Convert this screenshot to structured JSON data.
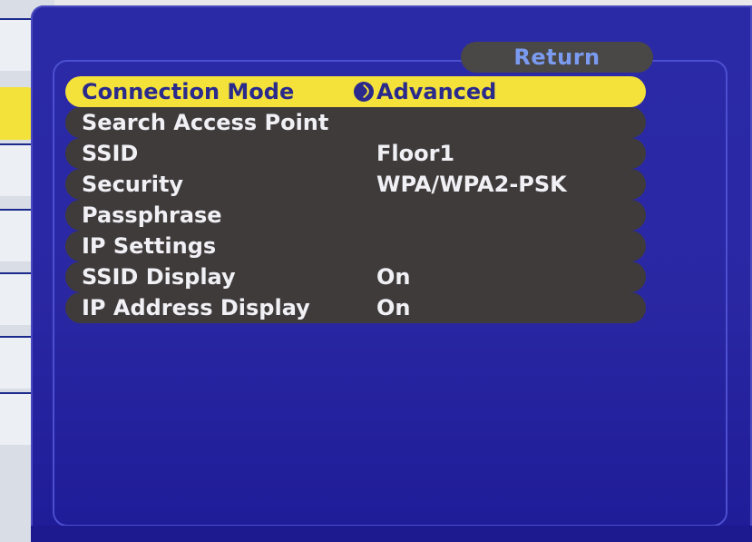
{
  "return_label": "Return",
  "rows": [
    {
      "label": "Connection Mode",
      "value": "Advanced"
    },
    {
      "label": "Search Access Point",
      "value": ""
    },
    {
      "label": "SSID",
      "value": "Floor1"
    },
    {
      "label": "Security",
      "value": "WPA/WPA2-PSK"
    },
    {
      "label": "Passphrase",
      "value": ""
    },
    {
      "label": "IP Settings",
      "value": ""
    },
    {
      "label": "SSID Display",
      "value": "On"
    },
    {
      "label": "IP Address Display",
      "value": "On"
    }
  ],
  "colors": {
    "panel_bg": "#2b2aa6",
    "row_bg": "#3f3b3b",
    "selected_bg": "#f4e23a",
    "text": "#f0f0f5",
    "return_text": "#7a9bf0"
  }
}
